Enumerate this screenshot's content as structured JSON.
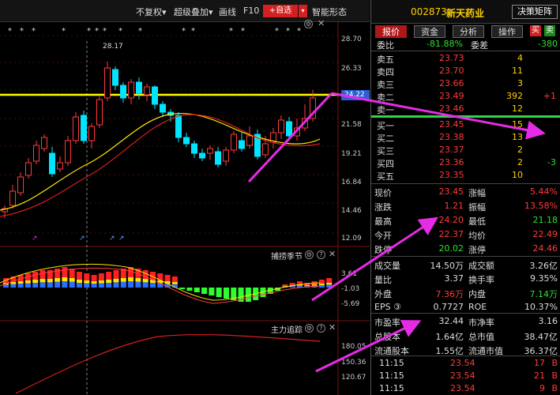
{
  "toolbar": {
    "fuquan": "不复权▾",
    "overlay": "超级叠加▾",
    "draw": "画线",
    "f10": "F10",
    "add_fav": "+自选",
    "fav_drop": "▾",
    "smart": "智能形态"
  },
  "chart": {
    "axis_labels": [
      "28.70",
      "26.33",
      "24.22",
      "21.58",
      "19.21",
      "16.84",
      "14.46",
      "12.09"
    ],
    "current_price_label": "24.22",
    "high_label": "28.17",
    "ind1_title": "捕捞季节",
    "ind1_axis": [
      "3.61",
      "-1.03",
      "-5.69"
    ],
    "ind2_title": "主力追踪",
    "ind2_axis": [
      "180.05",
      "150.36",
      "120.67"
    ]
  },
  "header": {
    "code": "002873",
    "name": "新天药业",
    "decision_btn": "决策矩阵"
  },
  "tabs": [
    "报价",
    "资金",
    "分析",
    "操作"
  ],
  "side_tags": [
    "买",
    "卖"
  ],
  "weibi": {
    "l1": "委比",
    "v1": "-81.88%",
    "l2": "委差",
    "v2": "-380"
  },
  "asks": [
    {
      "label": "卖五",
      "price": "23.73",
      "vol": "4",
      "chg": ""
    },
    {
      "label": "卖四",
      "price": "23.70",
      "vol": "11",
      "chg": ""
    },
    {
      "label": "卖三",
      "price": "23.66",
      "vol": "3",
      "chg": ""
    },
    {
      "label": "卖二",
      "price": "23.49",
      "vol": "392",
      "chg": "+1"
    },
    {
      "label": "卖一",
      "price": "23.46",
      "vol": "12",
      "chg": ""
    }
  ],
  "bids": [
    {
      "label": "买一",
      "price": "23.45",
      "vol": "15",
      "chg": ""
    },
    {
      "label": "买二",
      "price": "23.38",
      "vol": "13",
      "chg": ""
    },
    {
      "label": "买三",
      "price": "23.37",
      "vol": "2",
      "chg": ""
    },
    {
      "label": "买四",
      "price": "23.36",
      "vol": "2",
      "chg": "-3"
    },
    {
      "label": "买五",
      "price": "23.35",
      "vol": "10",
      "chg": ""
    }
  ],
  "quote": [
    {
      "l1": "现价",
      "v1": "23.45",
      "l2": "涨幅",
      "v2": "5.44%"
    },
    {
      "l1": "涨跌",
      "v1": "1.21",
      "l2": "振幅",
      "v2": "13.58%"
    },
    {
      "l1": "最高",
      "v1": "24.20",
      "l2": "最低",
      "v2": "21.18"
    },
    {
      "l1": "今开",
      "v1": "22.37",
      "l2": "均价",
      "v2": "22.49"
    },
    {
      "l1": "跌停",
      "v1": "20.02",
      "l2": "涨停",
      "v2": "24.46"
    }
  ],
  "stats": [
    {
      "l1": "成交量",
      "v1": "14.50万",
      "l2": "成交额",
      "v2": "3.26亿"
    },
    {
      "l1": "量比",
      "v1": "3.37",
      "l2": "换手率",
      "v2": "9.35%"
    },
    {
      "l1": "外盘",
      "v1": "7.36万",
      "l2": "内盘",
      "v2": "7.14万"
    },
    {
      "l1": "EPS ③",
      "v1": "0.7727",
      "l2": "ROE",
      "v2": "10.37%"
    }
  ],
  "fin": [
    {
      "l1": "市盈率",
      "v1": "32.44",
      "l2": "市净率",
      "v2": "3.16"
    },
    {
      "l1": "总股本",
      "v1": "1.64亿",
      "l2": "总市值",
      "v2": "38.47亿"
    },
    {
      "l1": "流通股本",
      "v1": "1.55亿",
      "l2": "流通市值",
      "v2": "36.37亿"
    }
  ],
  "ticks": [
    {
      "time": "11:15",
      "price": "23.54",
      "vol": "17",
      "dir": "B"
    },
    {
      "time": "11:15",
      "price": "23.54",
      "vol": "21",
      "dir": "B"
    },
    {
      "time": "11:15",
      "price": "23.54",
      "vol": "9",
      "dir": "B"
    }
  ],
  "colors": {
    "up": "#ff3b3b",
    "down": "#00e5ff",
    "ma5": "#ffe600",
    "ma10": "#d81e1e",
    "highlight": "#ffff00",
    "arrow": "#e62be6"
  }
}
